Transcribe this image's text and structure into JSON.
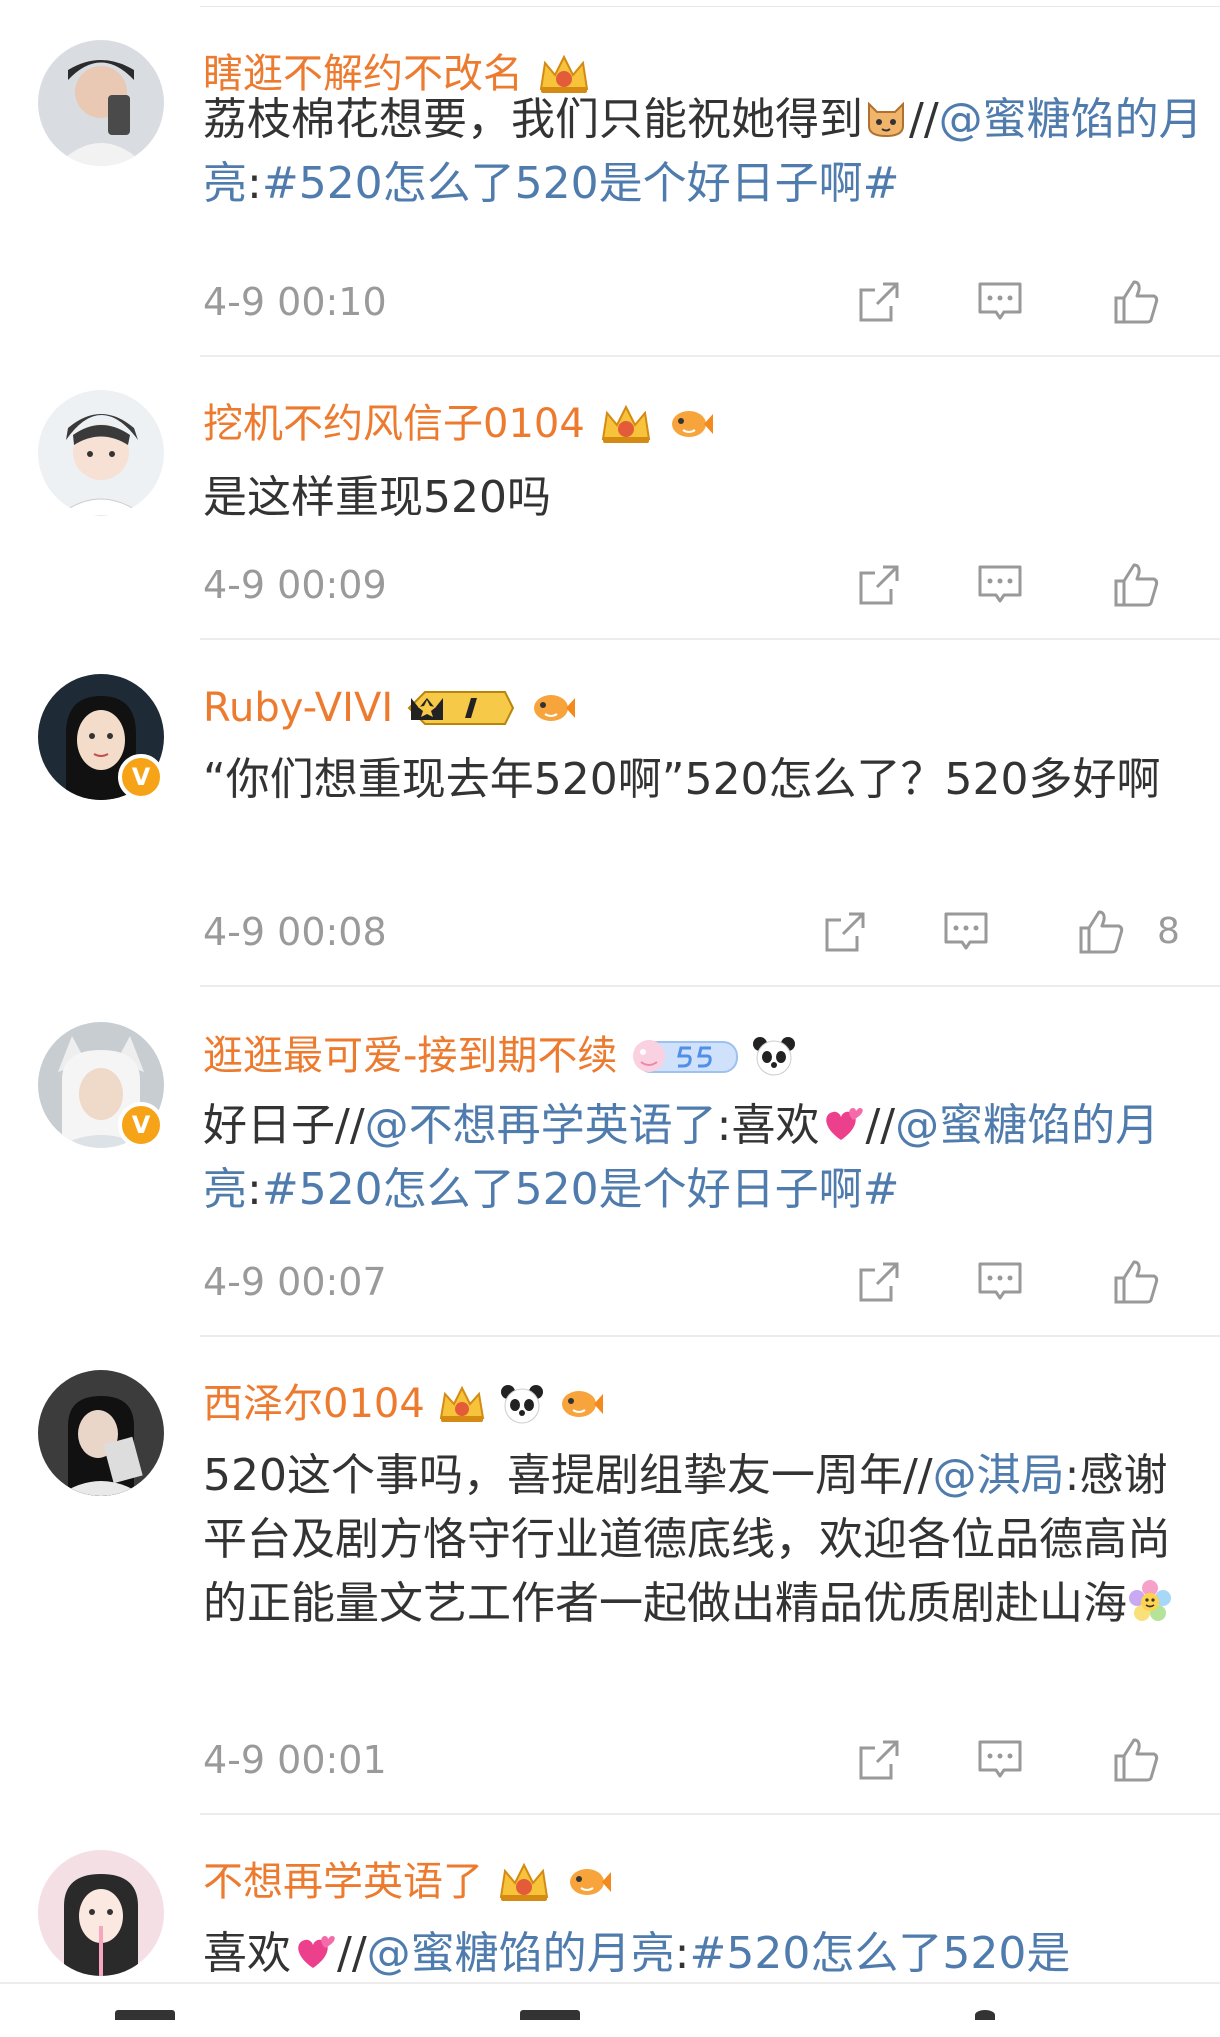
{
  "colors": {
    "username": "#ed7b2f",
    "link": "#4f7cad",
    "text": "#333333",
    "meta": "#9a9a9a"
  },
  "icons": {
    "share": "share-icon",
    "comment": "comment-icon",
    "like": "like-icon"
  },
  "comments": [
    {
      "username": "瞎逛不解约不改名",
      "content": {
        "t1": "荔枝棉花想要，我们只能祝她得到",
        "t2": "//",
        "mention1": "@蜜糖馅的月亮",
        "t3": ":",
        "tag1": "#520怎么了520是个好日子啊#"
      },
      "time": "4-9 00:10"
    },
    {
      "username": "挖机不约风信子0104",
      "content": {
        "t1": "是这样重现520吗"
      },
      "time": "4-9 00:09"
    },
    {
      "username": "Ruby-VIVI",
      "verified": "V",
      "content": {
        "t1": "“你们想重现去年520啊”520怎么了？520多好啊"
      },
      "time": "4-9 00:08",
      "like_count": "8"
    },
    {
      "username": "逛逛最可爱-接到期不续",
      "verified": "V",
      "content": {
        "t1": "好日子//",
        "mention1": "@不想再学英语了",
        "t2": ":喜欢",
        "t3": "//",
        "mention2": "@蜜糖馅的月亮",
        "t4": ":",
        "tag1": "#520怎么了520是个好日子啊#"
      },
      "time": "4-9 00:07"
    },
    {
      "username": "西泽尔0104",
      "content": {
        "t1": "520这个事吗，喜提剧组挚友一周年//",
        "mention1": "@淇局",
        "t2": ":感谢平台及剧方恪守行业道德底线，欢迎各位品德高尚的正能量文艺工作者一起做出精品优质剧赴山海"
      },
      "time": "4-9 00:01"
    },
    {
      "username": "不想再学英语了",
      "content": {
        "t1": "喜欢",
        "t2": "//",
        "mention1": "@蜜糖馅的月亮",
        "t3": ":",
        "tag1": "#520怎么了520是"
      }
    }
  ]
}
